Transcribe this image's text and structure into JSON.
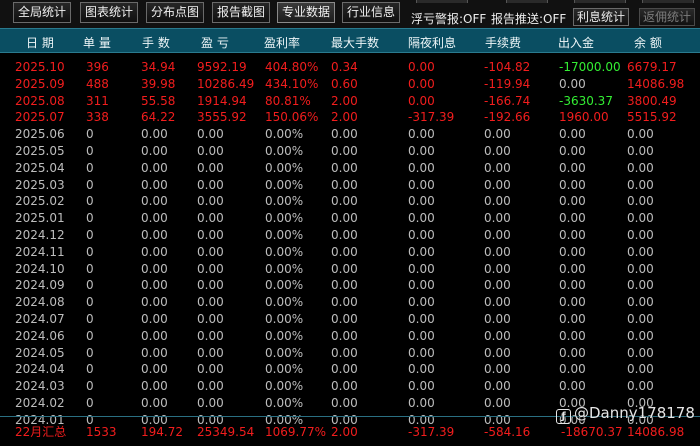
{
  "toolbar": {
    "buttons": [
      {
        "label": "全局统计"
      },
      {
        "label": "图表统计"
      },
      {
        "label": "分布点图"
      },
      {
        "label": "报告截图"
      },
      {
        "label": "专业数据"
      },
      {
        "label": "行业信息"
      }
    ],
    "float_warning": "浮亏警报:OFF",
    "report_push": "报告推送:OFF",
    "interest_stats_label": "利息统计",
    "rebate_stats_label": "返佣统计"
  },
  "table": {
    "headers": [
      "日 期",
      "单 量",
      "手 数",
      "盈 亏",
      "盈利率",
      "最大手数",
      "隔夜利息",
      "手续费",
      "出入金",
      "余 额"
    ],
    "rows": [
      {
        "date": "2025.10",
        "orders": "396",
        "lots": "34.94",
        "pnl": "9592.19",
        "rate": "404.80%",
        "max_lots": "0.34",
        "swap": "0.00",
        "fee": "-104.82",
        "deposit": "-17000.00",
        "balance": "6679.17",
        "row_color": "red",
        "deposit_color": "green"
      },
      {
        "date": "2025.09",
        "orders": "488",
        "lots": "39.98",
        "pnl": "10286.49",
        "rate": "434.10%",
        "max_lots": "0.60",
        "swap": "0.00",
        "fee": "-119.94",
        "deposit": "0.00",
        "balance": "14086.98",
        "row_color": "red",
        "deposit_color": "gray"
      },
      {
        "date": "2025.08",
        "orders": "311",
        "lots": "55.58",
        "pnl": "1914.94",
        "rate": "80.81%",
        "max_lots": "2.00",
        "swap": "0.00",
        "fee": "-166.74",
        "deposit": "-3630.37",
        "balance": "3800.49",
        "row_color": "red",
        "deposit_color": "green"
      },
      {
        "date": "2025.07",
        "orders": "338",
        "lots": "64.22",
        "pnl": "3555.92",
        "rate": "150.06%",
        "max_lots": "2.00",
        "swap": "-317.39",
        "fee": "-192.66",
        "deposit": "1960.00",
        "balance": "5515.92",
        "row_color": "red",
        "deposit_color": "red"
      },
      {
        "date": "2025.06",
        "orders": "0",
        "lots": "0.00",
        "pnl": "0.00",
        "rate": "0.00%",
        "max_lots": "0.00",
        "swap": "0.00",
        "fee": "0.00",
        "deposit": "0.00",
        "balance": "0.00",
        "row_color": "gray",
        "deposit_color": "gray"
      },
      {
        "date": "2025.05",
        "orders": "0",
        "lots": "0.00",
        "pnl": "0.00",
        "rate": "0.00%",
        "max_lots": "0.00",
        "swap": "0.00",
        "fee": "0.00",
        "deposit": "0.00",
        "balance": "0.00",
        "row_color": "gray",
        "deposit_color": "gray"
      },
      {
        "date": "2025.04",
        "orders": "0",
        "lots": "0.00",
        "pnl": "0.00",
        "rate": "0.00%",
        "max_lots": "0.00",
        "swap": "0.00",
        "fee": "0.00",
        "deposit": "0.00",
        "balance": "0.00",
        "row_color": "gray",
        "deposit_color": "gray"
      },
      {
        "date": "2025.03",
        "orders": "0",
        "lots": "0.00",
        "pnl": "0.00",
        "rate": "0.00%",
        "max_lots": "0.00",
        "swap": "0.00",
        "fee": "0.00",
        "deposit": "0.00",
        "balance": "0.00",
        "row_color": "gray",
        "deposit_color": "gray"
      },
      {
        "date": "2025.02",
        "orders": "0",
        "lots": "0.00",
        "pnl": "0.00",
        "rate": "0.00%",
        "max_lots": "0.00",
        "swap": "0.00",
        "fee": "0.00",
        "deposit": "0.00",
        "balance": "0.00",
        "row_color": "gray",
        "deposit_color": "gray"
      },
      {
        "date": "2025.01",
        "orders": "0",
        "lots": "0.00",
        "pnl": "0.00",
        "rate": "0.00%",
        "max_lots": "0.00",
        "swap": "0.00",
        "fee": "0.00",
        "deposit": "0.00",
        "balance": "0.00",
        "row_color": "gray",
        "deposit_color": "gray"
      },
      {
        "date": "2024.12",
        "orders": "0",
        "lots": "0.00",
        "pnl": "0.00",
        "rate": "0.00%",
        "max_lots": "0.00",
        "swap": "0.00",
        "fee": "0.00",
        "deposit": "0.00",
        "balance": "0.00",
        "row_color": "gray",
        "deposit_color": "gray"
      },
      {
        "date": "2024.11",
        "orders": "0",
        "lots": "0.00",
        "pnl": "0.00",
        "rate": "0.00%",
        "max_lots": "0.00",
        "swap": "0.00",
        "fee": "0.00",
        "deposit": "0.00",
        "balance": "0.00",
        "row_color": "gray",
        "deposit_color": "gray"
      },
      {
        "date": "2024.10",
        "orders": "0",
        "lots": "0.00",
        "pnl": "0.00",
        "rate": "0.00%",
        "max_lots": "0.00",
        "swap": "0.00",
        "fee": "0.00",
        "deposit": "0.00",
        "balance": "0.00",
        "row_color": "gray",
        "deposit_color": "gray"
      },
      {
        "date": "2024.09",
        "orders": "0",
        "lots": "0.00",
        "pnl": "0.00",
        "rate": "0.00%",
        "max_lots": "0.00",
        "swap": "0.00",
        "fee": "0.00",
        "deposit": "0.00",
        "balance": "0.00",
        "row_color": "gray",
        "deposit_color": "gray"
      },
      {
        "date": "2024.08",
        "orders": "0",
        "lots": "0.00",
        "pnl": "0.00",
        "rate": "0.00%",
        "max_lots": "0.00",
        "swap": "0.00",
        "fee": "0.00",
        "deposit": "0.00",
        "balance": "0.00",
        "row_color": "gray",
        "deposit_color": "gray"
      },
      {
        "date": "2024.07",
        "orders": "0",
        "lots": "0.00",
        "pnl": "0.00",
        "rate": "0.00%",
        "max_lots": "0.00",
        "swap": "0.00",
        "fee": "0.00",
        "deposit": "0.00",
        "balance": "0.00",
        "row_color": "gray",
        "deposit_color": "gray"
      },
      {
        "date": "2024.06",
        "orders": "0",
        "lots": "0.00",
        "pnl": "0.00",
        "rate": "0.00%",
        "max_lots": "0.00",
        "swap": "0.00",
        "fee": "0.00",
        "deposit": "0.00",
        "balance": "0.00",
        "row_color": "gray",
        "deposit_color": "gray"
      },
      {
        "date": "2024.05",
        "orders": "0",
        "lots": "0.00",
        "pnl": "0.00",
        "rate": "0.00%",
        "max_lots": "0.00",
        "swap": "0.00",
        "fee": "0.00",
        "deposit": "0.00",
        "balance": "0.00",
        "row_color": "gray",
        "deposit_color": "gray"
      },
      {
        "date": "2024.04",
        "orders": "0",
        "lots": "0.00",
        "pnl": "0.00",
        "rate": "0.00%",
        "max_lots": "0.00",
        "swap": "0.00",
        "fee": "0.00",
        "deposit": "0.00",
        "balance": "0.00",
        "row_color": "gray",
        "deposit_color": "gray"
      },
      {
        "date": "2024.03",
        "orders": "0",
        "lots": "0.00",
        "pnl": "0.00",
        "rate": "0.00%",
        "max_lots": "0.00",
        "swap": "0.00",
        "fee": "0.00",
        "deposit": "0.00",
        "balance": "0.00",
        "row_color": "gray",
        "deposit_color": "gray"
      },
      {
        "date": "2024.02",
        "orders": "0",
        "lots": "0.00",
        "pnl": "0.00",
        "rate": "0.00%",
        "max_lots": "0.00",
        "swap": "0.00",
        "fee": "0.00",
        "deposit": "0.00",
        "balance": "0.00",
        "row_color": "gray",
        "deposit_color": "gray"
      },
      {
        "date": "2024.01",
        "orders": "0",
        "lots": "0.00",
        "pnl": "0.00",
        "rate": "0.00%",
        "max_lots": "0.00",
        "swap": "0.00",
        "fee": "0.00",
        "deposit": "0.00",
        "balance": "0.00",
        "row_color": "gray",
        "deposit_color": "gray"
      }
    ],
    "summary": {
      "date": "22月汇总",
      "orders": "1533",
      "lots": "194.72",
      "pnl": "25349.54",
      "rate": "1069.77%",
      "max_lots": "2.00",
      "swap": "-317.39",
      "fee": "-584.16",
      "deposit": "-18670.37",
      "balance": "14086.98"
    }
  },
  "watermark": {
    "icon": "weibo-icon",
    "text": "@Danny178178"
  },
  "colors": {
    "header_bg": "#0a4e62",
    "loss_profit_red": "#f21d1d",
    "withdraw_green": "#33ee33",
    "zero_gray": "#bdbdbd"
  }
}
